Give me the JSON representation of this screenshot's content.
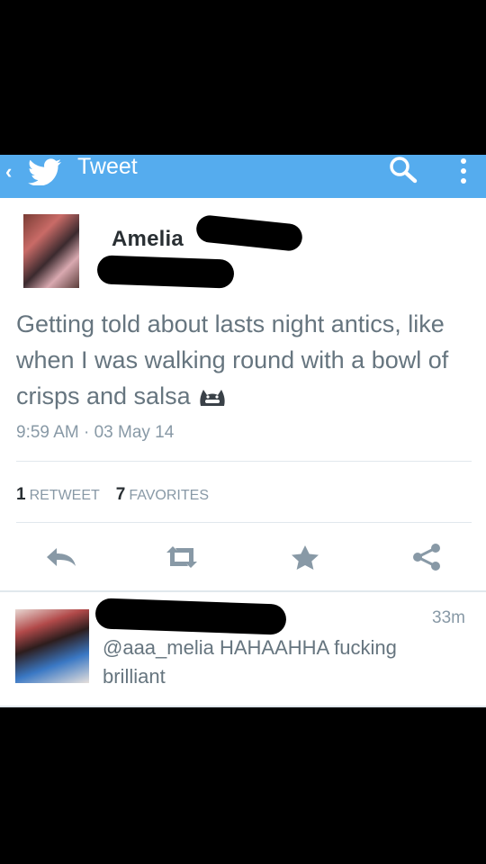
{
  "header": {
    "back_glyph": "‹",
    "title": "Tweet"
  },
  "tweet": {
    "name": "Amelia",
    "text": "Getting told about lasts night antics, like when I was walking round with a bowl of crisps and salsa",
    "time": "9:59 AM · 03 May 14",
    "retweet_count": "1",
    "retweet_label": "RETWEET",
    "favorite_count": "7",
    "favorite_label": "FAVORITES"
  },
  "actions": [
    "reply-icon",
    "retweet-icon",
    "favorite-icon",
    "share-icon"
  ],
  "reply_tweet": {
    "time_ago": "33m",
    "text": "@aaa_melia HAHAAHHA fucking brilliant"
  },
  "colors": {
    "header_bg": "#55acee",
    "text": "#66757f",
    "meta": "#8899a6",
    "icon": "#8899a6"
  }
}
